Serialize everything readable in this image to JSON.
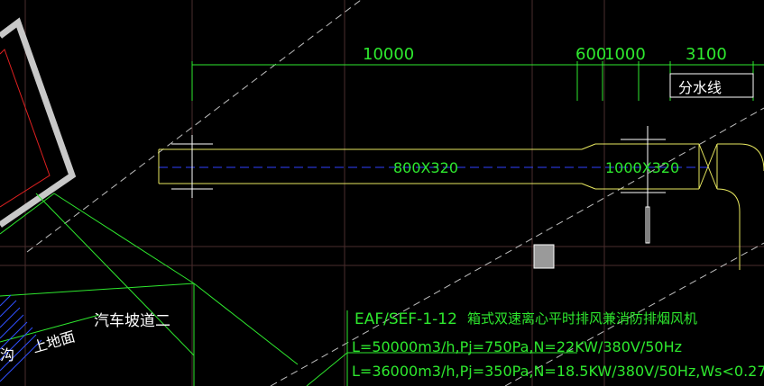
{
  "drawing": {
    "dimension_labels": [
      "10000",
      "600",
      "1000",
      "3100"
    ],
    "water_divide_label": "分水线",
    "duct_label_left": "800X320",
    "duct_label_right": "1000X320",
    "ramp_label": "汽车坡道二",
    "ground_label": "上地面",
    "ditch_label": "沟",
    "equipment": {
      "tag": "EAF/SEF-1-12",
      "description": "箱式双速离心平时排风兼消防排烟风机",
      "spec_line_1": "L=50000m3/h,Pj=750Pa,N=22KW/380V/50Hz",
      "spec_line_2": "L=36000m3/h,Pj=350Pa,N=18.5KW/380V/50Hz,Ws<0.27"
    }
  },
  "colors": {
    "background": "#000000",
    "dimension": "#2ee82e",
    "duct": "#e8e860",
    "centerline": "#3040ff",
    "grid": "#5a3a3a",
    "text_white": "#ffffff",
    "wall_outer": "#c8c8c8",
    "wall_red": "#e02020"
  }
}
